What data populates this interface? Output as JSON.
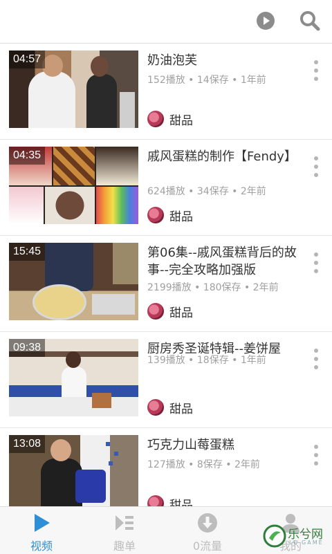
{
  "videos": [
    {
      "duration": "04:57",
      "title": "奶油泡芙",
      "meta": "152播放 • 14保存 • 1年前",
      "channel": "甜品"
    },
    {
      "duration": "04:35",
      "title": "戚风蛋糕的制作【Fendy】",
      "meta": "624播放 • 34保存 • 2年前",
      "channel": "甜品"
    },
    {
      "duration": "15:45",
      "title": "第06集--戚风蛋糕背后的故事--完全攻略加强版",
      "meta": "2199播放 • 180保存 • 2年前",
      "channel": "甜品"
    },
    {
      "duration": "09:38",
      "title": "厨房秀圣诞特辑--姜饼屋",
      "meta": "139播放 • 18保存 • 1年前",
      "channel": "甜品"
    },
    {
      "duration": "13:08",
      "title": "巧克力山莓蛋糕",
      "meta": "127播放 • 8保存 • 2年前",
      "channel": "甜品"
    }
  ],
  "tabs": [
    {
      "label": "视频",
      "icon": "play-icon",
      "active": true
    },
    {
      "label": "趣单",
      "icon": "playlist-icon",
      "active": false
    },
    {
      "label": "0流量",
      "icon": "download-icon",
      "active": false
    },
    {
      "label": "我的",
      "icon": "person-icon",
      "active": false
    }
  ],
  "watermark": {
    "text": "乐兮网",
    "sub": "LE GAME"
  },
  "colors": {
    "accent": "#2e8fd6",
    "meta_text": "#a0a0a0",
    "icon_gray": "#8c8c8c"
  }
}
